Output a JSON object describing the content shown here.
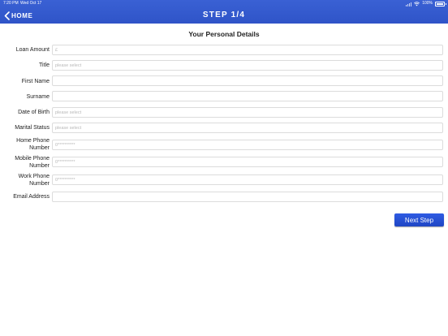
{
  "status_bar": {
    "time": "7:20 PM",
    "date": "Wed Oct 17",
    "battery": "100%"
  },
  "nav": {
    "back_label": "HOME",
    "title": "STEP 1/4"
  },
  "form": {
    "title": "Your Personal Details",
    "fields": [
      {
        "label": "Loan Amount",
        "placeholder": "£"
      },
      {
        "label": "Title",
        "placeholder": "please select"
      },
      {
        "label": "First Name",
        "placeholder": ""
      },
      {
        "label": "Surname",
        "placeholder": ""
      },
      {
        "label": "Date of Birth",
        "placeholder": "please select"
      },
      {
        "label": "Marital Status",
        "placeholder": "please select"
      },
      {
        "label": "Home Phone Number",
        "placeholder": "0**********"
      },
      {
        "label": "Mobile Phone Number",
        "placeholder": "0**********"
      },
      {
        "label": "Work Phone Number",
        "placeholder": "0**********"
      },
      {
        "label": "Email Address",
        "placeholder": ""
      }
    ],
    "next_label": "Next Step"
  },
  "colors": {
    "header_blue": "#2f54c8",
    "button_blue": "#1f46c4"
  }
}
